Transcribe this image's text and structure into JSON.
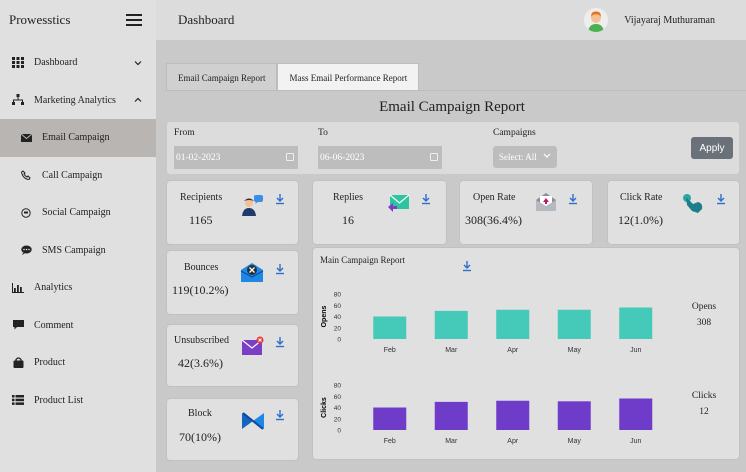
{
  "app": {
    "brand": "Prowesstics"
  },
  "header": {
    "title": "Dashboard",
    "user_name": "Vijayaraj Muthuraman"
  },
  "sidebar": {
    "items": [
      {
        "label": "Dashboard",
        "icon": "grid-icon"
      },
      {
        "label": "Marketing Analytics",
        "icon": "sitemap-icon"
      },
      {
        "label": "Email Campaign",
        "icon": "envelope-icon"
      },
      {
        "label": "Call Campaign",
        "icon": "phone-icon"
      },
      {
        "label": "Social Campaign",
        "icon": "social-icon"
      },
      {
        "label": "SMS Campaign",
        "icon": "sms-icon"
      },
      {
        "label": "Analytics",
        "icon": "bar-chart-icon"
      },
      {
        "label": "Comment",
        "icon": "comment-icon"
      },
      {
        "label": "Product",
        "icon": "bag-icon"
      },
      {
        "label": "Product List",
        "icon": "list-icon"
      }
    ]
  },
  "tabs": [
    {
      "label": "Email Campaign Report"
    },
    {
      "label": "Mass Email Performance Report"
    }
  ],
  "report": {
    "title": "Email Campaign Report"
  },
  "filters": {
    "from_label": "From",
    "from_value": "01-02-2023",
    "to_label": "To",
    "to_value": "06-06-2023",
    "campaigns_label": "Campaigns",
    "campaigns_value": "Select: All",
    "apply_label": "Apply"
  },
  "stats": {
    "recipients": {
      "label": "Recipients",
      "value": "1165"
    },
    "replies": {
      "label": "Replies",
      "value": "16"
    },
    "open_rate": {
      "label": "Open Rate",
      "value": "308(36.4%)"
    },
    "click_rate": {
      "label": "Click Rate",
      "value": "12(1.0%)"
    },
    "bounces": {
      "label": "Bounces",
      "value": "119(10.2%)"
    },
    "unsubscribed": {
      "label": "Unsubscribed",
      "value": "42(3.6%)"
    },
    "block": {
      "label": "Block",
      "value": "70(10%)"
    }
  },
  "main_report": {
    "title": "Main Campaign Report",
    "opens_label": "Opens",
    "opens_total": "308",
    "clicks_label": "Clicks",
    "clicks_total": "12"
  },
  "colors": {
    "opens": "#45c9b8",
    "clicks": "#6f3bc9",
    "accent": "#2f6fcc"
  },
  "chart_data": [
    {
      "type": "bar",
      "categories": [
        "Feb",
        "Mar",
        "Apr",
        "May",
        "Jun"
      ],
      "ylabel": "Opens",
      "yticks": [
        0,
        20,
        40,
        60,
        80
      ],
      "ylim": [
        0,
        80
      ],
      "values": [
        40,
        50,
        52,
        52,
        56
      ]
    },
    {
      "type": "bar",
      "categories": [
        "Feb",
        "Mar",
        "Apr",
        "May",
        "Jun"
      ],
      "ylabel": "Clicks",
      "yticks": [
        0,
        20,
        40,
        60,
        80
      ],
      "ylim": [
        0,
        80
      ],
      "values": [
        40,
        50,
        52,
        51,
        56
      ]
    }
  ]
}
